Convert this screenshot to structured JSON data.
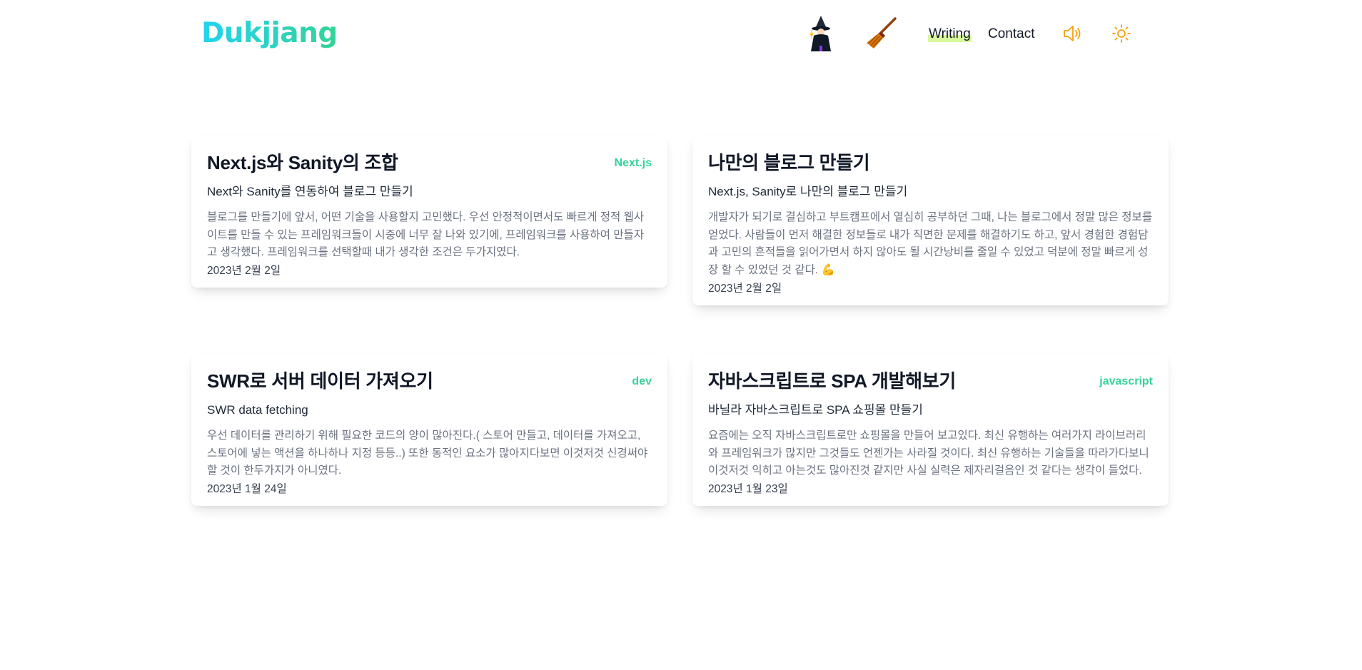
{
  "header": {
    "logo": "Dukjjang",
    "nav": {
      "writing": "Writing",
      "contact": "Contact"
    },
    "icons": [
      "witch-icon",
      "broom-icon",
      "speaker-icon",
      "sun-icon"
    ]
  },
  "colors": {
    "logo_gradient_start": "#22d3ee",
    "logo_gradient_end": "#34d399",
    "tag": "#34d399",
    "writing_highlight": "#d9f99d",
    "icon_accent": "#f59e0b"
  },
  "posts": [
    {
      "title": "Next.js와 Sanity의 조합",
      "tag": "Next.js",
      "subtitle": "Next와 Sanity를 연동하여 블로그 만들기",
      "description": "블로그를 만들기에 앞서, 어떤 기술을 사용할지 고민했다. 우선 안정적이면서도 빠르게 정적 웹사이트를 만들 수 있는 프레임워크들이 시중에 너무 잘 나와 있기에, 프레임워크를 사용하여 만들자고 생각했다. 프레임워크를 선택할때 내가 생각한 조건은 두가지였다.",
      "date": "2023년 2월 2일"
    },
    {
      "title": "나만의 블로그 만들기",
      "tag": "",
      "subtitle": "Next.js, Sanity로 나만의 블로그 만들기",
      "description": "개발자가 되기로 결심하고 부트캠프에서 열심히 공부하던 그때, 나는 블로그에서 정말 많은 정보를 얻었다. 사람들이 먼저 해결한 정보들로 내가 직면한 문제를 해결하기도 하고, 앞서 경험한 경험담과 고민의 흔적들을 읽어가면서 하지 않아도 될 시간낭비를 줄일 수 있었고 덕분에 정말 빠르게 성장 할 수 있었던 것 같다. 💪",
      "date": "2023년 2월 2일"
    },
    {
      "title": "SWR로 서버 데이터 가져오기",
      "tag": "dev",
      "subtitle": "SWR data fetching",
      "description": "우선 데이터를 관리하기 위해 필요한 코드의 양이 많아진다.( 스토어 만들고, 데이터를 가져오고, 스토어에 넣는 액션을 하나하나 지정 등등..) 또한 동적인 요소가 많아지다보면 이것저것 신경써야할 것이 한두가지가 아니였다.",
      "date": "2023년 1월 24일"
    },
    {
      "title": "자바스크립트로 SPA 개발해보기",
      "tag": "javascript",
      "subtitle": "바닐라 자바스크립트로 SPA 쇼핑몰 만들기",
      "description": "요즘에는 오직 자바스크립트로만 쇼핑몰을 만들어 보고있다. 최신 유행하는 여러가지 라이브러리와 프레임워크가 많지만 그것들도 언젠가는 사라질 것이다. 최신 유행하는 기술들을 따라가다보니 이것저것 익히고 아는것도 많아진것 같지만 사실 실력은 제자리걸음인 것 같다는 생각이 들었다.",
      "date": "2023년 1월 23일"
    }
  ]
}
